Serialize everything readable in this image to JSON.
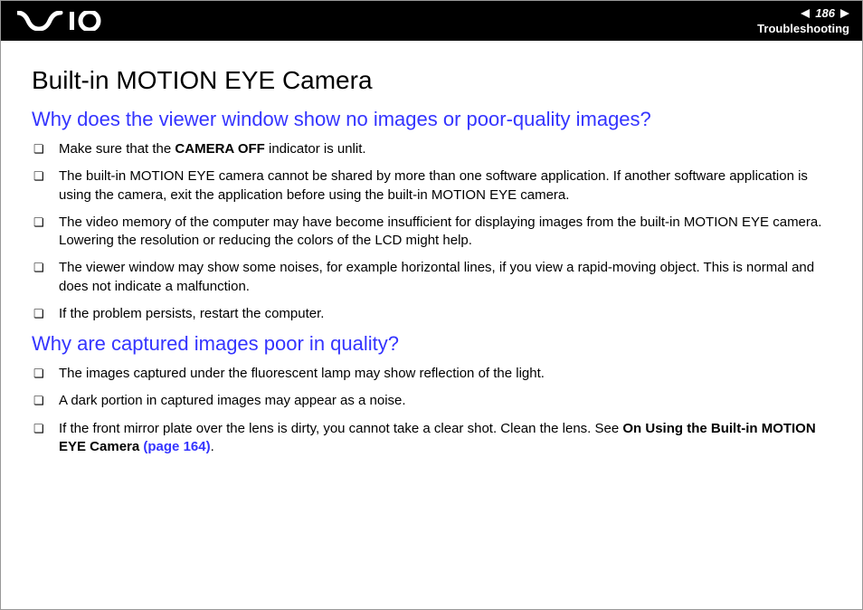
{
  "header": {
    "page_number": "186",
    "section": "Troubleshooting"
  },
  "main": {
    "title": "Built-in MOTION EYE Camera",
    "sections": [
      {
        "heading": "Why does the viewer window show no images or poor-quality images?",
        "items": [
          {
            "pre": "Make sure that the ",
            "bold": "CAMERA OFF",
            "post": " indicator is unlit."
          },
          {
            "pre": "The built-in MOTION EYE camera cannot be shared by more than one software application. If another software application is using the camera, exit the application before using the built-in MOTION EYE camera.",
            "bold": "",
            "post": ""
          },
          {
            "pre": "The video memory of the computer may have become insufficient for displaying images from the built-in MOTION EYE camera. Lowering the resolution or reducing the colors of the LCD might help.",
            "bold": "",
            "post": ""
          },
          {
            "pre": "The viewer window may show some noises, for example horizontal lines, if you view a rapid-moving object. This is normal and does not indicate a malfunction.",
            "bold": "",
            "post": ""
          },
          {
            "pre": "If the problem persists, restart the computer.",
            "bold": "",
            "post": ""
          }
        ]
      },
      {
        "heading": "Why are captured images poor in quality?",
        "items": [
          {
            "pre": "The images captured under the fluorescent lamp may show reflection of the light.",
            "bold": "",
            "post": ""
          },
          {
            "pre": "A dark portion in captured images may appear as a noise.",
            "bold": "",
            "post": ""
          },
          {
            "pre": "If the front mirror plate over the lens is dirty, you cannot take a clear shot. Clean the lens. See ",
            "bold": "On Using the Built-in MOTION EYE Camera ",
            "post": "",
            "link": "(page 164)",
            "tail": "."
          }
        ]
      }
    ]
  }
}
